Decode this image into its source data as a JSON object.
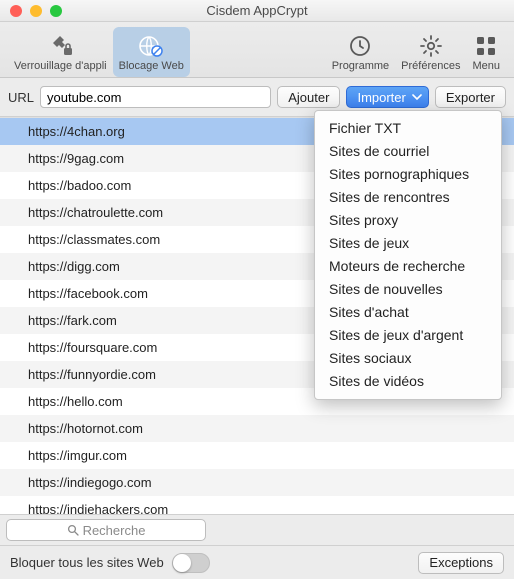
{
  "window": {
    "title": "Cisdem AppCrypt"
  },
  "toolbar": {
    "app_lock": "Verrouillage d'appli",
    "web_block": "Blocage Web",
    "schedule": "Programme",
    "preferences": "Préférences",
    "menu": "Menu"
  },
  "urlbar": {
    "label": "URL",
    "value": "youtube.com",
    "add": "Ajouter",
    "import": "Importer",
    "export": "Exporter"
  },
  "import_menu": [
    "Fichier TXT",
    "Sites de courriel",
    "Sites pornographiques",
    "Sites de rencontres",
    "Sites proxy",
    "Sites de jeux",
    "Moteurs de recherche",
    "Sites de nouvelles",
    "Sites d'achat",
    "Sites de jeux d'argent",
    "Sites sociaux",
    "Sites de vidéos"
  ],
  "urls": [
    "https://4chan.org",
    "https://9gag.com",
    "https://badoo.com",
    "https://chatroulette.com",
    "https://classmates.com",
    "https://digg.com",
    "https://facebook.com",
    "https://fark.com",
    "https://foursquare.com",
    "https://funnyordie.com",
    "https://hello.com",
    "https://hotornot.com",
    "https://imgur.com",
    "https://indiegogo.com",
    "https://indiehackers.com"
  ],
  "search": {
    "placeholder": "Recherche"
  },
  "bottom": {
    "block_all": "Bloquer tous les sites Web",
    "exceptions": "Exceptions"
  }
}
